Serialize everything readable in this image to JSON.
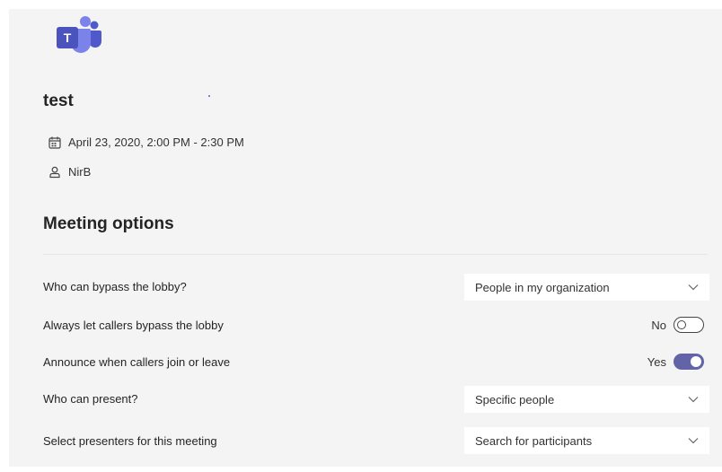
{
  "app": {
    "logo_letter": "T",
    "brand_color": "#6264a7"
  },
  "meeting": {
    "title": "test",
    "datetime": "April 23, 2020, 2:00 PM - 2:30 PM",
    "organizer": "NirB"
  },
  "section_title": "Meeting options",
  "options": {
    "bypass_lobby": {
      "label": "Who can bypass the lobby?",
      "value": "People in my organization"
    },
    "callers_bypass": {
      "label": "Always let callers bypass the lobby",
      "state_text": "No",
      "enabled": false
    },
    "announce": {
      "label": "Announce when callers join or leave",
      "state_text": "Yes",
      "enabled": true
    },
    "who_present": {
      "label": "Who can present?",
      "value": "Specific people"
    },
    "presenters": {
      "label": "Select presenters for this meeting",
      "placeholder": "Search for participants"
    }
  },
  "icons": {
    "calendar": "calendar-icon",
    "person": "person-icon",
    "chevron": "chevron-down-icon"
  }
}
